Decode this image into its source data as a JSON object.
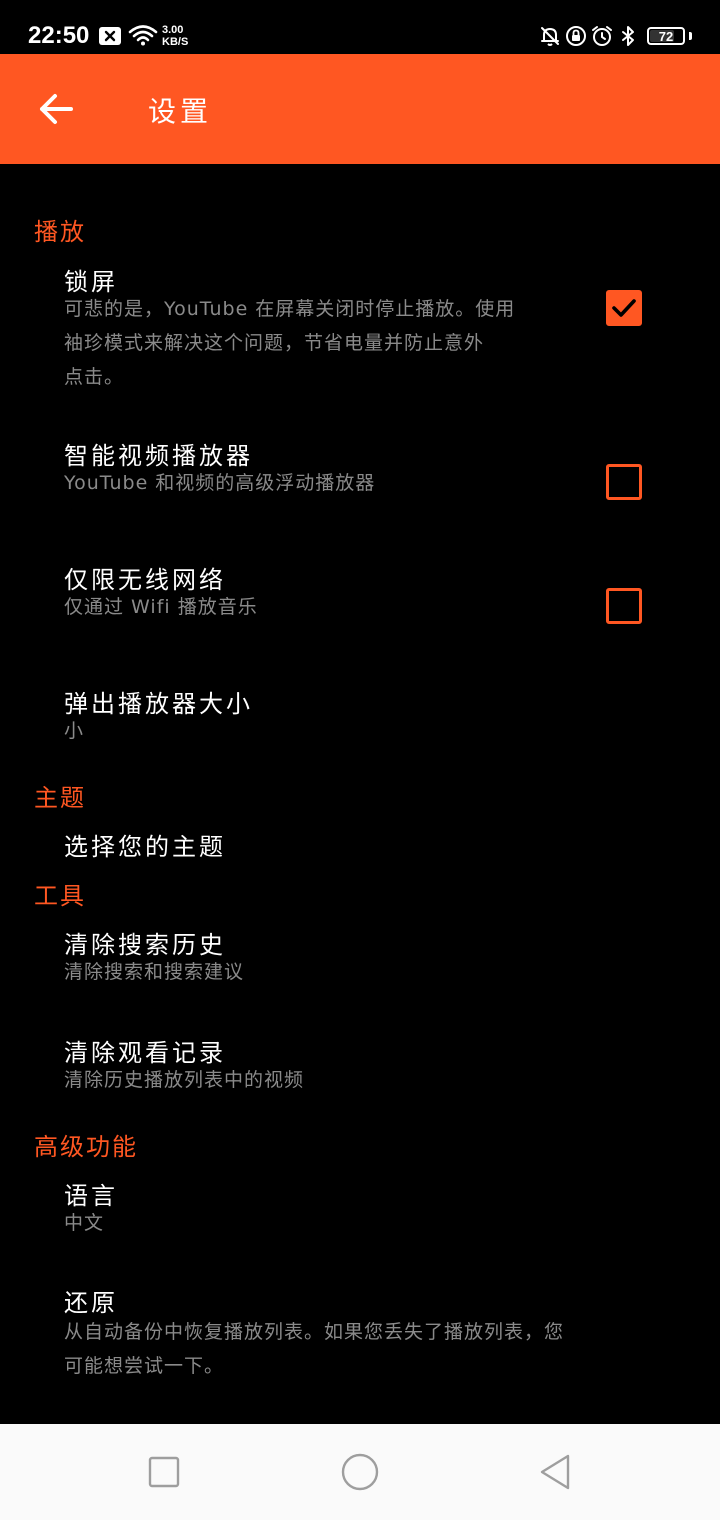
{
  "status_bar": {
    "time": "22:50",
    "net_speed_value": "3.00",
    "net_speed_unit": "KB/S",
    "battery": "72"
  },
  "toolbar": {
    "title": "设置"
  },
  "sections": {
    "playback": {
      "header": "播放",
      "lock_screen": {
        "title": "锁屏",
        "summary_line1": "可悲的是，YouTube 在屏幕关闭时停止播放。使用",
        "summary_line2": "袖珍模式来解决这个问题，节省电量并防止意外",
        "summary_line3": "点击。",
        "checked": true
      },
      "smart_player": {
        "title": "智能视频播放器",
        "summary": "YouTube 和视频的高级浮动播放器",
        "checked": false
      },
      "wifi_only": {
        "title": "仅限无线网络",
        "summary": "仅通过 Wifi 播放音乐",
        "checked": false
      },
      "popup_size": {
        "title": "弹出播放器大小",
        "summary": "小"
      }
    },
    "theme": {
      "header": "主题",
      "choose_theme": {
        "title": "选择您的主题"
      }
    },
    "tools": {
      "header": "工具",
      "clear_search": {
        "title": "清除搜索历史",
        "summary": "清除搜索和搜索建议"
      },
      "clear_watch": {
        "title": "清除观看记录",
        "summary": "清除历史播放列表中的视频"
      }
    },
    "advanced": {
      "header": "高级功能",
      "language": {
        "title": "语言",
        "summary": "中文"
      },
      "restore": {
        "title": "还原",
        "summary_line1": "从自动备份中恢复播放列表。如果您丢失了播放列表，您",
        "summary_line2": "可能想尝试一下。"
      }
    }
  },
  "colors": {
    "accent": "#ff5722",
    "background": "#000000",
    "summary_text": "#8a8a8a",
    "nav_bar": "#fafafa"
  },
  "icons": {
    "back": "arrow-left-icon",
    "check": "checkmark-icon",
    "nav_recents": "square-icon",
    "nav_home": "circle-icon",
    "nav_back": "triangle-icon"
  }
}
